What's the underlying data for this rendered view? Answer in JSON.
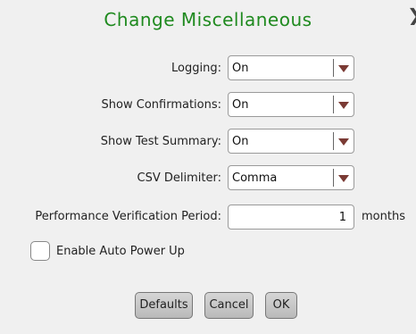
{
  "dialog": {
    "title": "Change Miscellaneous"
  },
  "fields": [
    {
      "label": "Logging:",
      "value": "On"
    },
    {
      "label": "Show Confirmations:",
      "value": "On"
    },
    {
      "label": "Show Test Summary:",
      "value": "On"
    },
    {
      "label": "CSV Delimiter:",
      "value": "Comma"
    }
  ],
  "verification": {
    "label": "Performance Verification Period:",
    "value": "1",
    "units": "months"
  },
  "auto_power": {
    "label": "Enable Auto Power Up",
    "checked": false
  },
  "buttons": {
    "defaults": "Defaults",
    "cancel": "Cancel",
    "ok": "OK"
  },
  "colors": {
    "title": "#1f8a1f",
    "dropdown_arrow": "#7a3a34",
    "background": "#f0f0f0"
  },
  "icons": {
    "close": "close-icon",
    "dropdown": "chevron-down-icon"
  }
}
